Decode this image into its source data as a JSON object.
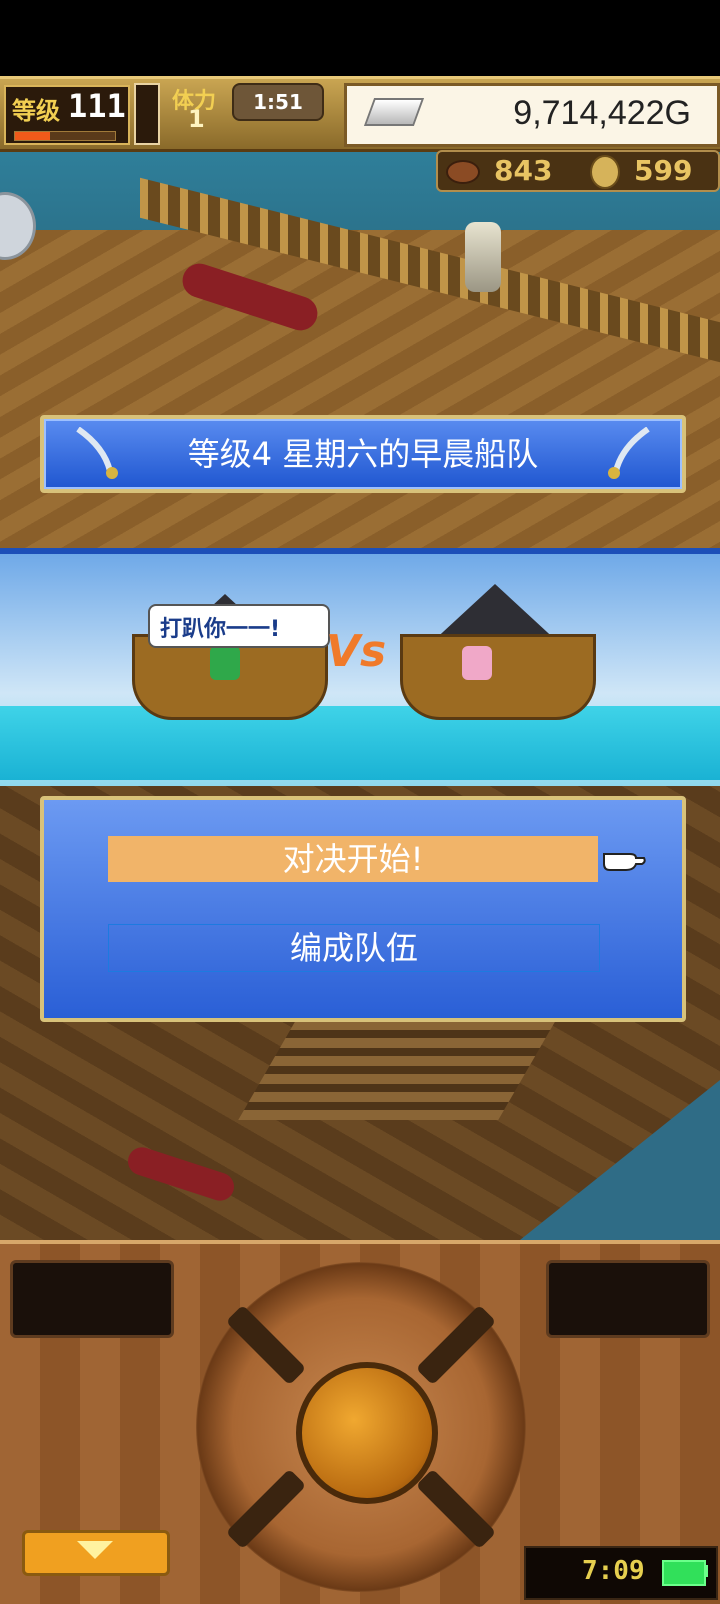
{
  "hud": {
    "level_label": "等级",
    "level_value": "111",
    "exp_progress": 0.35,
    "stamina_label": "体力",
    "stamina_value": "1",
    "timer": "1:51",
    "gold": "9,714,422G"
  },
  "resources": {
    "meat": "843",
    "coins": "599"
  },
  "banner": {
    "title": "等级4 星期六的早晨船队"
  },
  "battle": {
    "speech": "打趴你一一!",
    "vs": "Vs"
  },
  "menu": {
    "start": "对决开始!",
    "team": "编成队伍"
  },
  "device": {
    "clock": "7:09"
  },
  "icons": {
    "gold": "silver-bar-icon",
    "meat": "meat-icon",
    "coin": "medal-icon",
    "pointer": "hand-pointer-icon",
    "down": "triangle-down-icon"
  },
  "colors": {
    "panel_blue": "#2a5fd6",
    "selection": "#f1b469",
    "gold_trim": "#d8c27a"
  }
}
